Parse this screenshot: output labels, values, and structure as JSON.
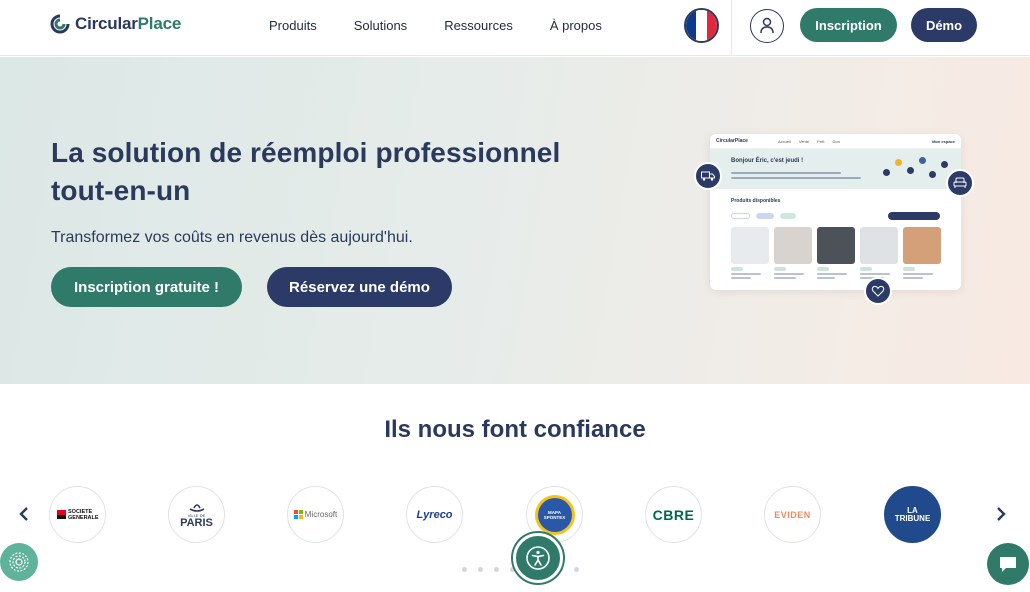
{
  "header": {
    "logo": {
      "part1": "Circular",
      "part2": "Place"
    },
    "nav": [
      "Produits",
      "Solutions",
      "Ressources",
      "À propos"
    ],
    "signup_label": "Inscription",
    "demo_label": "Démo"
  },
  "hero": {
    "title": "La solution de réemploi professionnel tout-en-un",
    "subtitle": "Transformez vos coûts en revenus dès aujourd'hui.",
    "cta_primary": "Inscription gratuite !",
    "cta_secondary": "Réservez une démo"
  },
  "mockup": {
    "logo": "CircularPlace",
    "nav": [
      "Accueil",
      "Vente",
      "Prêt",
      "Don"
    ],
    "space": "Mon espace",
    "greeting": "Bonjour Éric, c'est jeudi !",
    "products_title": "Produits disponibles"
  },
  "trust": {
    "title": "Ils nous font confiance",
    "logos": [
      {
        "name": "SOCIETE GENERALE"
      },
      {
        "name": "PARIS",
        "prefix": "VILLE DE"
      },
      {
        "name": "Microsoft"
      },
      {
        "name": "Lyreco"
      },
      {
        "name": "MAPA SPONTEX"
      },
      {
        "name": "CBRE"
      },
      {
        "name": "EVIDEN"
      },
      {
        "name": "LA TRIBUNE"
      }
    ]
  },
  "colors": {
    "green": "#2f7a69",
    "navy": "#2b3a66",
    "text": "#2b3a5c"
  }
}
